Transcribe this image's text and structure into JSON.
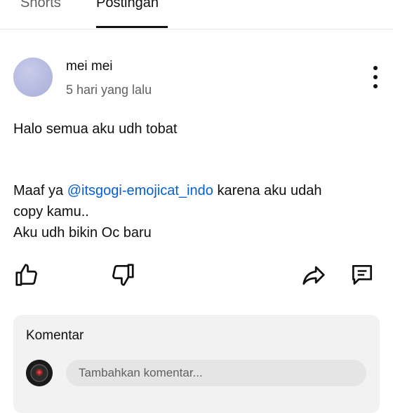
{
  "tabs": [
    {
      "label": "Shorts",
      "active": false
    },
    {
      "label": "Postingan",
      "active": true
    }
  ],
  "post": {
    "author": "mei mei",
    "time": "5 hari yang lalu",
    "lines": {
      "l1": "Halo semua aku udh tobat",
      "l2_pre": "Maaf ya ",
      "l2_mention": "@itsgogi-emojicat_indo",
      "l2_post": " karena aku udah",
      "l3": "copy kamu..",
      "l4": "Aku udh bikin Oc baru"
    }
  },
  "actions": [
    "like-icon",
    "dislike-icon",
    "share-icon",
    "comment-icon"
  ],
  "comments": {
    "title": "Komentar",
    "placeholder": "Tambahkan komentar..."
  },
  "colors": {
    "mention": "#065fd4",
    "secondary_text": "#606060",
    "comment_panel": "#f2f2f2"
  }
}
